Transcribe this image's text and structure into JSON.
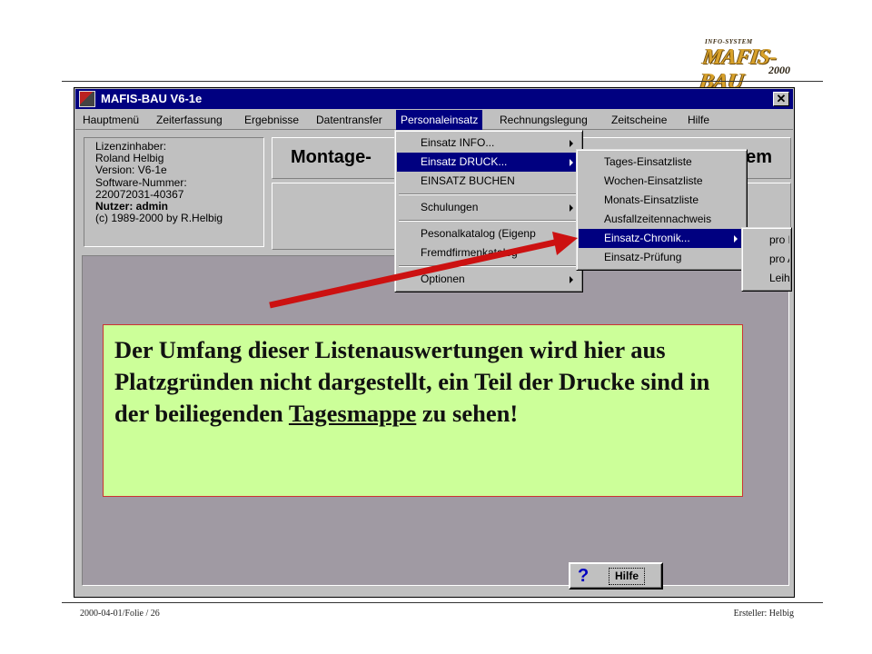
{
  "logo": {
    "small_text": "INFO-SYSTEM",
    "main_text": "MAFIS-BAU",
    "year": "2000"
  },
  "window": {
    "title": "MAFIS-BAU V6-1e",
    "close_glyph": "✕"
  },
  "menubar": {
    "items": [
      {
        "label": "Hauptmenü"
      },
      {
        "label": "Zeiterfassung"
      },
      {
        "label": "Ergebnisse"
      },
      {
        "label": "Datentransfer"
      },
      {
        "label": "Personaleinsatz"
      },
      {
        "label": "Rechnungslegung"
      },
      {
        "label": "Zeitscheine"
      },
      {
        "label": "Hilfe"
      }
    ]
  },
  "info_box": {
    "lines": [
      "Lizenzinhaber:",
      "Roland Helbig",
      "Version: V6-1e",
      "Software-Nummer:",
      "220072031-40367",
      "Nutzer: admin",
      "(c) 1989-2000 by R.Helbig"
    ]
  },
  "panels": {
    "montage": "Montage-",
    "right": "em"
  },
  "menu_personaleinsatz": {
    "items": [
      {
        "label": "Einsatz INFO..."
      },
      {
        "label": "Einsatz DRUCK..."
      },
      {
        "label": "EINSATZ  BUCHEN"
      },
      {
        "label": "Schulungen"
      },
      {
        "label": "Pesonalkatalog (Eigenp"
      },
      {
        "label": "Fremdfirmenkatalog"
      },
      {
        "label": "Optionen"
      }
    ]
  },
  "menu_druck": {
    "items": [
      {
        "label": "Tages-Einsatzliste"
      },
      {
        "label": "Wochen-Einsatzliste"
      },
      {
        "label": "Monats-Einsatzliste"
      },
      {
        "label": "Ausfallzeitennachweis"
      },
      {
        "label": "Einsatz-Chronik..."
      },
      {
        "label": "Einsatz-Prüfung"
      }
    ]
  },
  "menu_chronik": {
    "items": [
      {
        "label": "pro M"
      },
      {
        "label": "pro A"
      },
      {
        "label": "Leih"
      }
    ]
  },
  "help_button": {
    "icon": "?",
    "label": "Hilfe"
  },
  "callout": {
    "text_before": "Der Umfang dieser Listenauswertungen wird hier aus Platzgründen nicht dargestellt, ein Teil der Drucke sind in der beiliegenden ",
    "link_text": "Tagesmappe",
    "text_after": " zu sehen!"
  },
  "footer": {
    "left": "2000-04-01/Folie / 26",
    "right": "Ersteller: Helbig"
  },
  "colors": {
    "titlebar": "#000080",
    "callout_bg": "#ccff99",
    "arrow": "#cc1111",
    "gray_area": "#a09aa3"
  }
}
